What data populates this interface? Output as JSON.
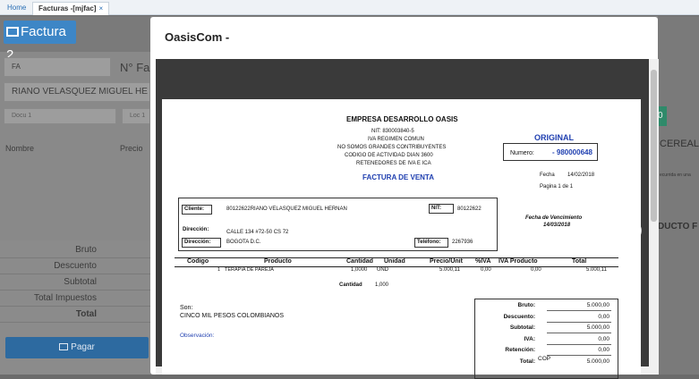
{
  "tabs": {
    "home": "Home",
    "active": "Facturas -[mjfac]",
    "close": "×"
  },
  "factura": {
    "title": "Factura 2",
    "tipo": "FA",
    "numero_label": "N° Fa",
    "cliente": "RIANO VELASQUEZ MIGUEL HE",
    "docu_placeholder": "Docu 1",
    "loc_placeholder": "Loc 1",
    "col_nombre": "Nombre",
    "col_precio": "Precio",
    "totals": [
      "Bruto",
      "Descuento",
      "Subtotal",
      "Total Impuestos",
      "Total"
    ],
    "pagar": "Pagar"
  },
  "right": {
    "cereal": "CEREAL",
    "producto": "DUCTO F",
    "value_badge": "0",
    "small_text": "ecurrida en una"
  },
  "modal": {
    "title": "OasisCom -"
  },
  "invoice": {
    "company": "EMPRESA DESARROLLO OASIS",
    "nit": "NIT: 830003840-5",
    "iva": "IVA REGIMEN COMUN",
    "contrib": "NO SOMOS GRANDES CONTRIBUYENTES",
    "codigo": "CODIGO DE ACTIVIDAD DIAN 3600",
    "retenedores": "RETENEDORES DE IVA E ICA",
    "doc_type": "FACTURA DE VENTA",
    "original": "ORIGINAL",
    "numero_label": "Numero:",
    "numero": "- 980000648",
    "fecha_label": "Fecha",
    "fecha": "14/02/2018",
    "pagina": "Pagina 1 de 1",
    "cliente_label": "Cliente:",
    "cliente": "80122622RIANO VELASQUEZ MIGUEL HERNAN",
    "nit_label": "NIT:",
    "nit_cliente": "80122622",
    "direccion_label": "Dirección:",
    "direccion": "CALLE 134 #72-50 CS 72",
    "ciudad": "BOGOTA D.C.",
    "telefono_label": "Teléfono:",
    "telefono": "2267936",
    "venc_label": "Fecha de Vencimiento",
    "venc": "14/03/2018",
    "headers": [
      "Codigo",
      "Producto",
      "Cantidad",
      "Unidad",
      "Precio/Unit",
      "%IVA",
      "IVA Producto",
      "Total"
    ],
    "item": {
      "codigo": "1",
      "producto": "TERAPIA DE PAREJA",
      "cantidad": "1,0000",
      "unidad": "UND",
      "precio": "5.000,11",
      "iva_pct": "0,00",
      "iva_prod": "0,00",
      "total": "5.000,11"
    },
    "cantidad_label": "Cantidad",
    "cantidad_total": "1,000",
    "son_label": "Son:",
    "son": "CINCO MIL PESOS COLOMBIANOS",
    "observacion": "Observación:",
    "summary": [
      {
        "label": "Bruto:",
        "value": "5.000,00"
      },
      {
        "label": "Descuento:",
        "value": "0,00"
      },
      {
        "label": "Subtotal:",
        "value": "5.000,00"
      },
      {
        "label": "IVA:",
        "value": "0,00"
      },
      {
        "label": "Retención:",
        "value": "0,00"
      },
      {
        "label": "Total:",
        "value": "5.000,00"
      }
    ],
    "currency": "COP"
  },
  "colors": {
    "accent": "#3d86c6",
    "brand_blue": "#1f3fb0",
    "overlay": "#898989"
  }
}
